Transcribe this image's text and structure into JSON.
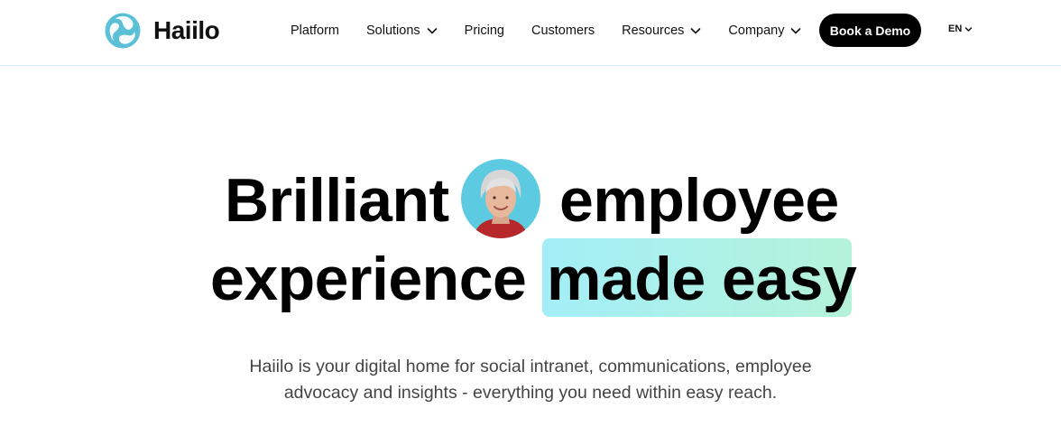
{
  "brand": {
    "name": "Haiilo"
  },
  "nav": {
    "items": [
      {
        "label": "Platform",
        "has_dropdown": false
      },
      {
        "label": "Solutions",
        "has_dropdown": true
      },
      {
        "label": "Pricing",
        "has_dropdown": false
      },
      {
        "label": "Customers",
        "has_dropdown": false
      },
      {
        "label": "Resources",
        "has_dropdown": true
      },
      {
        "label": "Company",
        "has_dropdown": true
      }
    ],
    "cta_label": "Book a Demo",
    "language": "EN"
  },
  "hero": {
    "headline_part1": "Brilliant",
    "headline_part2": "employee",
    "headline_part3": "experience",
    "headline_highlight": "made easy",
    "subtitle_line1": "Haiilo is your digital home for social intranet, communications, employee",
    "subtitle_line2": "advocacy and insights - everything you need within easy reach."
  },
  "colors": {
    "highlight_start": "#a3eef7",
    "highlight_end": "#b5f3d9",
    "brand_teal": "#5bc0d6",
    "cta_bg": "#000000"
  },
  "icons": [
    "haiilo-logo-icon",
    "chevron-down-icon",
    "avatar-photo"
  ]
}
